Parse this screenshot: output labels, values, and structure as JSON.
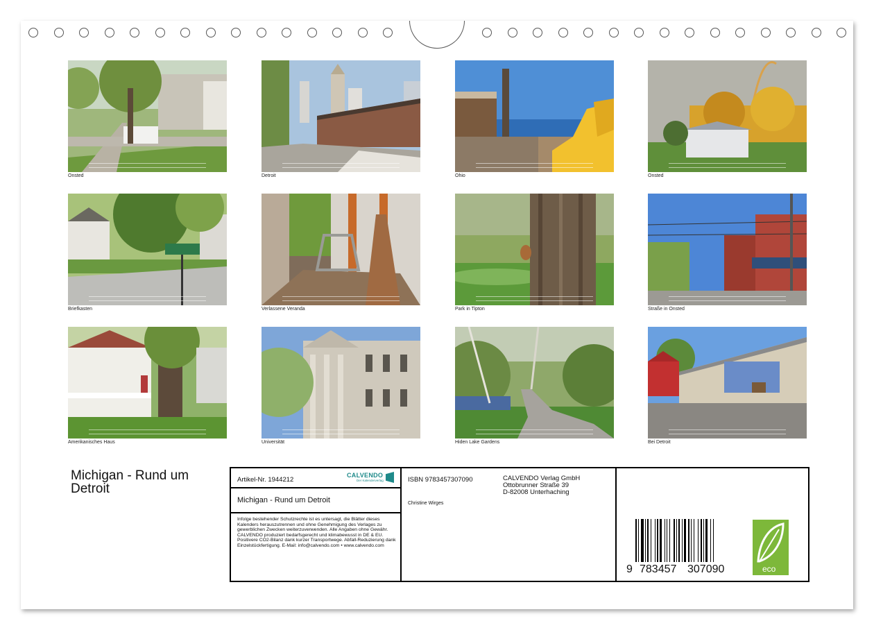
{
  "photos": [
    {
      "caption": "Onsted",
      "scene": "street-sidewalk"
    },
    {
      "caption": "Detroit",
      "scene": "city-townhouses"
    },
    {
      "caption": "Ohio",
      "scene": "lake-beach-chair"
    },
    {
      "caption": "Onsted",
      "scene": "shed-rainbow"
    },
    {
      "caption": "Briefkasten",
      "scene": "house-street-sign"
    },
    {
      "caption": "Verlassene Veranda",
      "scene": "porch-chairs"
    },
    {
      "caption": "Park in Tipton",
      "scene": "tree-squirrel"
    },
    {
      "caption": "Straße in Onsted",
      "scene": "brick-main-street"
    },
    {
      "caption": "Amerikanisches Haus",
      "scene": "white-porch-house"
    },
    {
      "caption": "Universität",
      "scene": "university-building"
    },
    {
      "caption": "Hiden Lake Gardens",
      "scene": "forest-path"
    },
    {
      "caption": "Bei Detroit",
      "scene": "barn-mural"
    }
  ],
  "calendar_title": "Michigan - Rund um Detroit",
  "info": {
    "article": "Artikel-Nr. 1944212",
    "brand": "CALVENDO",
    "brand_sub": "Der Kalenderverlag",
    "product_title": "Michigan - Rund um Detroit",
    "legal": "Infolge bestehender Schutzrechte ist es untersagt, die Blätter dieses Kalenders herauszutrennen und ohne Genehmigung des Verlages zu gewerblichen Zwecken weiterzuverwenden. Alle Angaben ohne Gewähr. CALVENDO produziert bedarfsgerecht und klimabewusst in DE & EU. Positivere CO2-Bilanz dank kurzer Transportwege. Abfall-Reduzierung dank Einzelstückfertigung. E-Mail: info@calvendo.com • www.calvendo.com",
    "isbn": "ISBN 9783457307090",
    "author": "Christine Wirges",
    "publisher_1": "CALVENDO Verlag GmbH",
    "publisher_2": "Ottobrunner Straße 39",
    "publisher_3": "D-82008 Unterhaching",
    "barcode_1": "9",
    "barcode_2": "783457",
    "barcode_3": "307090",
    "eco": "eco"
  },
  "colors": {
    "eco_green": "#7db83a",
    "calvendo_teal": "#1f8a8a"
  }
}
